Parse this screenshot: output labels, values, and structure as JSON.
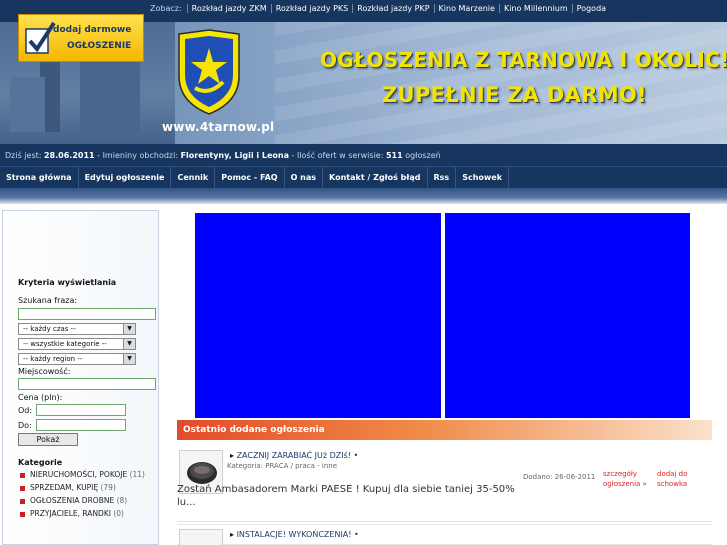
{
  "topbar": {
    "label": "Zobacz:",
    "links": [
      "Rozkład jazdy ZKM",
      "Rozkład jazdy PKS",
      "Rozkład jazdy PKP",
      "Kino Marzenie",
      "Kino Millennium",
      "Pogoda"
    ]
  },
  "banner": {
    "url": "www.4tarnow.pl",
    "slogan_line1": "OGŁOSZENIA Z TARNOWA I OKOLIC!",
    "slogan_line2": "ZUPEŁNIE ZA DARMO!"
  },
  "info": {
    "date_label": "Dziś jest:",
    "date": "28.06.2011",
    "names_label": "- Imieniny obchodzi:",
    "names": "Florentyny, Ligii i Leona",
    "count_label": "- Ilość ofert w serwisie:",
    "count": "511",
    "count_suffix": "ogłoszeń"
  },
  "nav": {
    "items": [
      "Strona główna",
      "Edytuj ogłoszenie",
      "Cennik",
      "Pomoc - FAQ",
      "O nas",
      "Kontakt / Zgłoś błąd",
      "Rss",
      "Schowek"
    ]
  },
  "sidebar": {
    "promo_line1": "dodaj darmowe",
    "promo_line2": "OGŁOSZENIE",
    "filters_heading": "Kryteria wyświetlania",
    "phrase_label": "Szukana fraza:",
    "phrase_value": "",
    "time_select": "-- każdy czas --",
    "category_select": "-- wszystkie kategorie --",
    "region_select": "-- każdy region --",
    "city_label": "Miejscowość:",
    "city_value": "",
    "price_label": "Cena (pln):",
    "from_label": "Od:",
    "to_label": "Do:",
    "from_value": "",
    "to_value": "",
    "show_button": "Pokaż",
    "categories_heading": "Kategorie",
    "categories": [
      {
        "name": "NIERUCHOMOŚCI, POKOJE",
        "count": "(11)"
      },
      {
        "name": "SPRZEDAM, KUPIĘ",
        "count": "(79)"
      },
      {
        "name": "OGŁOSZENIA DROBNE",
        "count": "(8)"
      },
      {
        "name": "PRZYJACIELE, RANDKI",
        "count": "(0)"
      }
    ]
  },
  "main": {
    "section_title": "Ostatnio dodane ogłoszenia",
    "ads": [
      {
        "title": "ZACZNIJ ZARABIAĆ JUż DZIś! •",
        "category": "Kategoria: PRACA / praca - inne",
        "date": "Dodano: 26-06-2011",
        "details_link": "szczegóły ogłoszenia »",
        "save_link": "dodaj do schowka",
        "description": "Zostań Ambasadorem Marki PAESE ! Kupuj dla siebie taniej 35-50% lu..."
      },
      {
        "title": "INSTALACJE! WYKOŃCZENIA! •"
      }
    ]
  },
  "colors": {
    "header_navy": "#16365f",
    "slogan_yellow": "#f2e400",
    "ad_blue": "#0000ff",
    "section_orange": "#e34b2a",
    "link_red": "#dd2222"
  }
}
